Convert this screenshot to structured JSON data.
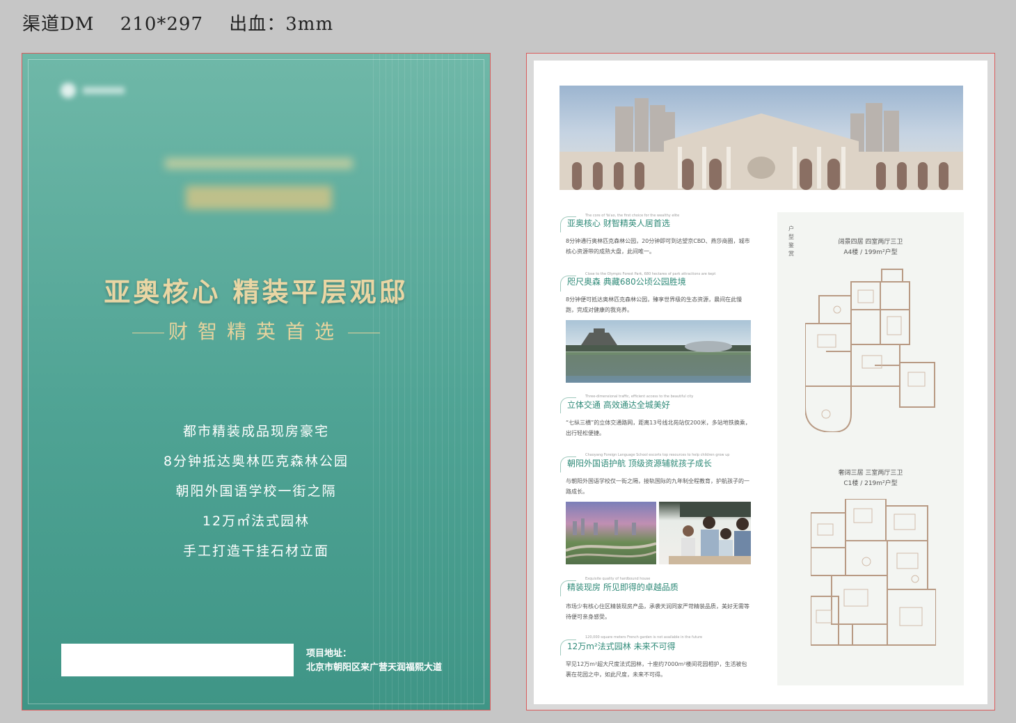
{
  "spec": {
    "channel": "渠道DM",
    "size": "210*297",
    "bleed": "出血：3mm"
  },
  "front": {
    "headline": "亚奥核心 精装平层观邸",
    "subtitle": "财智精英首选",
    "features": [
      "都市精装成品现房豪宅",
      "8分钟抵达奥林匹克森林公园",
      "朝阳外国语学校一街之隔",
      "12万㎡法式园林",
      "手工打造干挂石材立面"
    ],
    "address_label": "项目地址：",
    "address": "北京市朝阳区来广营天润福熙大道"
  },
  "back": {
    "sections": [
      {
        "en": "The core of Ya'ao, the first choice for the wealthy elite",
        "title": "亚奥核心 财智精英人居首选",
        "body": "8分钟通行奥林匹克森林公园，20分钟即可到达望京CBD、燕莎商圈，城市核心资源带的成熟大盘，此间唯一。"
      },
      {
        "en": "Close to the Olympic Forest Park, 680 hectares of park attractions are kept",
        "title": "咫尺奥森 典藏680公顷公园胜境",
        "body": "8分钟便可抵达奥林匹克森林公园，臻享世界级的生态资源，晨间在此慢跑，完成对健康的我充养。"
      },
      {
        "en": "Three-dimensional traffic, efficient access to the beautiful city",
        "title": "立体交通 高效通达全城美好",
        "body": "“七纵三横”的立体交通路网，距离13号线北苑站仅200米，多站地铁换乘，出行轻松便捷。"
      },
      {
        "en": "Chaoyang Foreign Language School escorts top resources to help children grow up",
        "title": "朝阳外国语护航 顶级资源辅就孩子成长",
        "body": "与朝阳外国语学校仅一街之隔，接轨国际的九年制全程教育，护航孩子的一路成长。"
      },
      {
        "en": "Exquisite quality of hardbound house",
        "title": "精装现房 所见即得的卓越品质",
        "body": "市场少有核心住区精装现房产品，承袭天润同家严苛精装品质，美好无需等待便可亲身感受。"
      },
      {
        "en": "120,000 square meters French garden is not available in the future",
        "title": "12万m²法式园林 未来不可得",
        "body": "罕见12万m²超大尺度法式园林，十座约7000m²楼间花园相护，生活被包裹在花园之中，如此尺度，未来不可得。"
      }
    ],
    "plan_label": "户\n型\n鉴\n赏",
    "plans": [
      {
        "name": "阔景四居 四室两厅三卫",
        "spec": "A4楼 / 199m²户型"
      },
      {
        "name": "奢阔三居 三室两厅三卫",
        "spec": "C1楼 / 219m²户型"
      }
    ]
  }
}
